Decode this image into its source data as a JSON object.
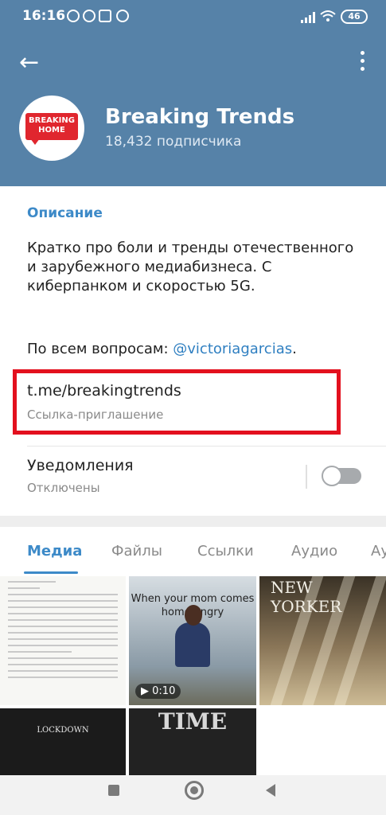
{
  "status_bar": {
    "time": "16:16",
    "battery": "46"
  },
  "channel": {
    "title": "Breaking Trends",
    "subscribers": "18,432 подписчика",
    "avatar_line1": "BREAKING",
    "avatar_line2": "HOME"
  },
  "info": {
    "description_label": "Описание",
    "description_text": "Кратко про боли и тренды отечественного и зарубежного медиабизнеса. С киберпанком и скоростью 5G.",
    "questions_prefix": "По всем вопросам: ",
    "questions_handle": "@victoriagarcias",
    "questions_suffix": ".",
    "invite_link": "t.me/breakingtrends",
    "invite_link_label": "Ссылка-приглашение",
    "notifications_label": "Уведомления",
    "notifications_status": "Отключены"
  },
  "media_tabs": [
    "Медиа",
    "Файлы",
    "Ссылки",
    "Аудио",
    "Ау"
  ],
  "media_grid": {
    "video_caption": "When your mom comes home angry",
    "video_duration": "0:10",
    "tile_newyorker": "NEW YORKER",
    "tile_lockdown": "LOCKDOWN",
    "tile_time": "TIME"
  },
  "colors": {
    "header": "#5682a8",
    "accent": "#3d8ac8",
    "highlight": "#e3101e"
  }
}
